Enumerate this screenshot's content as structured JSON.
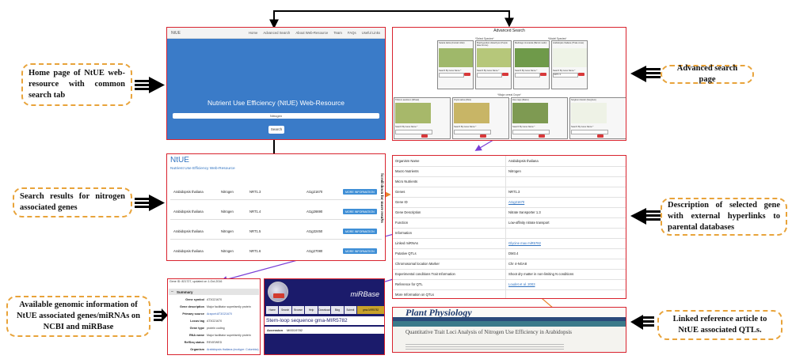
{
  "callouts": {
    "home": "Home page of NtUE web-resource with common search tab",
    "search_results": "Search results for nitrogen associated genes",
    "genomic_info": "Available genomic information of NtUE associated genes/miRNAs on NCBI and miRBase",
    "advanced_search": "Advanced search page",
    "description": "Description of selected gene with external hyperlinks to parental databases",
    "linked_reference": "Linked reference article to NtUE associated QTLs."
  },
  "colors": {
    "callout_border": "#e8a33a",
    "panel_border": "#d9232e",
    "home_blue": "#3a7bc8",
    "connector_purple": "#7a3fd6",
    "connector_orange": "#e8812a",
    "mirbase_navy": "#1b1b6b"
  },
  "home_page": {
    "brand": "NtUE",
    "nav": [
      "Home",
      "Advanced Search",
      "About Web-Resource",
      "Team",
      "FAQs",
      "Useful Links"
    ],
    "title": "Nutrient Use Efficiency (NtUE) Web-Resource",
    "search_value": "Nitrogen",
    "search_button": "Search"
  },
  "results_page": {
    "brand": "NtUE",
    "subtitle": "Nutrient Use Efficiency Web-Resource",
    "scroll_note": "Scroll down for more results",
    "rows": [
      {
        "organism": "Arabidopsis thaliana",
        "nutrient": "Nitrogen",
        "gene": "NRT1.3",
        "locus": "At1g21670",
        "button": "MORE INFORMATION"
      },
      {
        "organism": "Arabidopsis thaliana",
        "nutrient": "Nitrogen",
        "gene": "NRT1.4",
        "locus": "At1g26690",
        "button": "MORE INFORMATION"
      },
      {
        "organism": "Arabidopsis thaliana",
        "nutrient": "Nitrogen",
        "gene": "NRT1.5",
        "locus": "At1g32450",
        "button": "MORE INFORMATION"
      },
      {
        "organism": "Arabidopsis thaliana",
        "nutrient": "Nitrogen",
        "gene": "NRT1.6",
        "locus": "At1g27080",
        "button": "MORE INFORMATION"
      }
    ]
  },
  "advanced_page": {
    "header": "Advanced Search",
    "group_top_left": "*Select Species*",
    "group_top_right": "*Model Species*",
    "group_bottom": "*Major cereal Crops*",
    "top_species": [
      "Setaria italica (Foxtail millet)",
      "Brachypodium distachyon (Purple false brome)",
      "Medicago truncatula (Barrel medic)",
      "Arabidopsis thaliana (Thale cress)"
    ],
    "bottom_species": [
      "Triticum aestivum (Wheat)",
      "Oryza sativa (Rice)",
      "Zea mays (Maize)",
      "Sorghum bicolor (Sorghum)"
    ],
    "field_label": "Search By Gene Name *",
    "field_value": "NRT1.3"
  },
  "description_page": {
    "rows": [
      {
        "label": "Organism Name",
        "value": "Arabidopsis thaliana",
        "link": false
      },
      {
        "label": "Macro Nutrients",
        "value": "Nitrogen",
        "link": false
      },
      {
        "label": "Micro Nutrients",
        "value": "",
        "link": false
      },
      {
        "label": "Genes",
        "value": "NRT1.3",
        "link": false
      },
      {
        "label": "Gene ID",
        "value": "At1g21670",
        "link": true
      },
      {
        "label": "Gene Description",
        "value": "Nitrate transporter 1.3",
        "link": false
      },
      {
        "label": "Function",
        "value": "Low-affinity nitrate transport",
        "link": false
      },
      {
        "label": "Information",
        "value": "",
        "link": false
      },
      {
        "label": "Linked miRNAs",
        "value": "Glycine max miR5782",
        "link": true
      },
      {
        "label": "Putative QTLs",
        "value": "DM3.4",
        "link": false
      },
      {
        "label": "Chromosomal location Marker",
        "value": "Chr 4-NGA8",
        "link": false
      },
      {
        "label": "Experimental conditions Trait Information",
        "value": "Shoot dry matter in non-limiting N conditions",
        "link": false
      },
      {
        "label": "Reference for QTL",
        "value": "Loudet et al. 2003",
        "link": true
      },
      {
        "label": "More Information on QTLs",
        "value": "",
        "link": false
      }
    ]
  },
  "ncbi_panel": {
    "header": "Gene ID: 821727, updated on 1-Oct-2016",
    "section": "Summary",
    "fields": [
      {
        "label": "Gene symbol",
        "value": "AT3G21670"
      },
      {
        "label": "Gene description",
        "value": "Major facilitator superfamily protein"
      },
      {
        "label": "Primary source",
        "value": "Araport:AT3G21670"
      },
      {
        "label": "Locus tag",
        "value": "AT3G21670"
      },
      {
        "label": "Gene type",
        "value": "protein coding"
      },
      {
        "label": "RNA name",
        "value": "Major facilitator superfamily protein"
      },
      {
        "label": "RefSeq status",
        "value": "REVIEWED"
      },
      {
        "label": "Organism",
        "value": "Arabidopsis thaliana (ecotype: Columbia)"
      }
    ]
  },
  "mirbase_panel": {
    "logo_text": "miRBase",
    "tabs": [
      "Home",
      "Search",
      "Browse",
      "Help",
      "Download",
      "Blog",
      "Submit",
      "gma-MIR5782"
    ],
    "heading": "Stem-loop sequence gma-MIR5782",
    "accession_label": "Accession",
    "accession_value": "MI0019782"
  },
  "journal_panel": {
    "journal": "Plant Physiology",
    "article_title": "Quantitative Trait Loci Analysis of Nitrogen Use Efficiency in Arabidopsis"
  }
}
